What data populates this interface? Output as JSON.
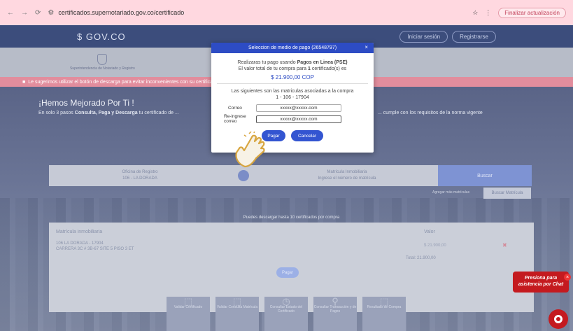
{
  "browser": {
    "url": "certificados.supernotariado.gov.co/certificado",
    "update_button": "Finalizar actualización"
  },
  "site": {
    "brand": "$ GOV.CO",
    "top_buttons": [
      "Iniciar sesión",
      "Registrarse"
    ],
    "logo_text": "Superintendencia de Notariado y Registro",
    "alert": "Le sugerimos utilizar el botón de descarga para evitar inconvenientes con su certificado"
  },
  "hero": {
    "title": "¡Hemos Mejorado Por Ti !",
    "subtitle_prefix": "En solo 3 pasos ",
    "subtitle_bold": "Consulta, Paga y Descarga",
    "subtitle_suffix": " tu certificado de ...",
    "subtitle_right": "... cumple con los requisitos de la norma vigente"
  },
  "search": {
    "field1_label": "Oficina de Registro",
    "field1_value": "106 - LA DORADA",
    "field2_label": "Matrícula Inmobiliaria",
    "field2_placeholder": "Ingrese el número de matrícula",
    "button": "Buscar",
    "note": "Agregar más matrículas",
    "mini_button": "Buscar Matrícula"
  },
  "results": {
    "caption": "Puedes descargar hasta 10 certificados por compra",
    "col_matricula": "Matrícula inmobiliaria",
    "col_valor": "Valor",
    "row_office": "106 LA DORADA - 17904",
    "row_address": "CARRERA 3C # 3B-67 SITE 5 PISO 3 ET",
    "row_value": "$ 21.900,00",
    "total": "Total: 21.900,00",
    "pay_button": "Pagar"
  },
  "tiles": [
    {
      "icon": "⬚",
      "label": "Validar Certificado"
    },
    {
      "icon": "⬚",
      "label": "Validar Consulta Matrícula"
    },
    {
      "icon": "◷",
      "label": "Consultar Estado del Certificado"
    },
    {
      "icon": "⚲",
      "label": "Consultar Transacción y de Pagos"
    },
    {
      "icon": "⬚",
      "label": "Resultado de Compra"
    }
  ],
  "chat": {
    "bubble": "Presiona para asistencia por Chat"
  },
  "modal": {
    "title": "Seleccion de medio de pago (26548797)",
    "line1_prefix": "Realizaras tu pago usando ",
    "line1_bold": "Pagos en Linea (PSE)",
    "line2_prefix": "El valor total de tu compra para ",
    "line2_bold": "1",
    "line2_suffix": " certificado(s) es",
    "amount": "$ 21.900,00 COP",
    "line3": "Las siguientes son las matriculas asociadas a la compra",
    "matriculas": "1 - 106 - 17904",
    "email_label": "Correo",
    "email_value": "xxxxx@xxxxx.com",
    "reemail_label": "Re-ingrese correo",
    "reemail_value": "xxxxx@xxxxx.com",
    "pay_button": "Pagar",
    "cancel_button": "Cancelar"
  }
}
